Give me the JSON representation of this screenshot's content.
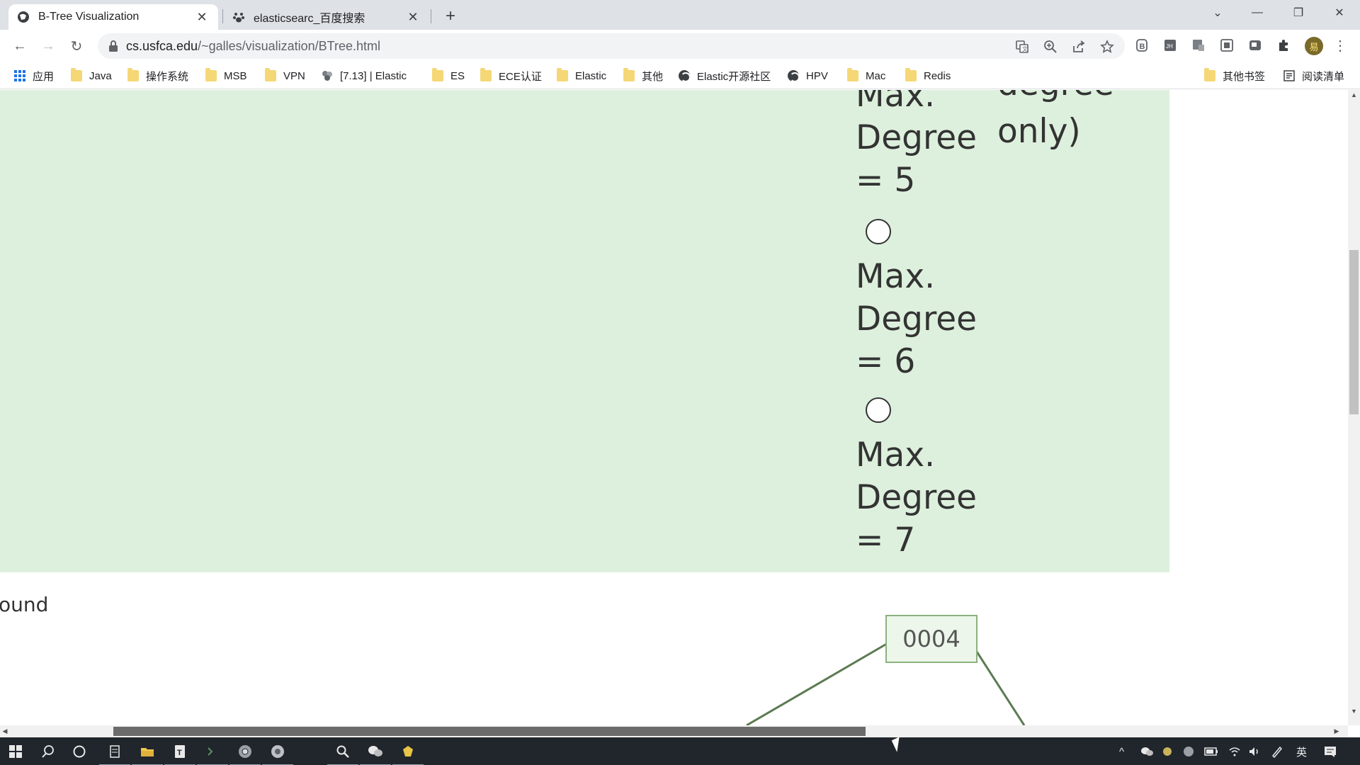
{
  "browser": {
    "tabs": [
      {
        "title": "B-Tree Visualization",
        "active": true,
        "icon": "globe-icon"
      },
      {
        "title": "elasticsearc_百度搜索",
        "active": false,
        "icon": "baidu-paw-icon"
      }
    ],
    "url_domain": "cs.usfca.edu",
    "url_path": "/~galles/visualization/BTree.html"
  },
  "bookmarks": [
    {
      "label": "应用",
      "icon": "apps-grid-icon"
    },
    {
      "label": "Java",
      "icon": "folder-icon"
    },
    {
      "label": "操作系统",
      "icon": "folder-icon"
    },
    {
      "label": "MSB",
      "icon": "folder-icon"
    },
    {
      "label": "VPN",
      "icon": "folder-icon"
    },
    {
      "label": "[7.13] | Elastic",
      "icon": "elastic-icon"
    },
    {
      "label": "ES",
      "icon": "folder-icon"
    },
    {
      "label": "ECE认证",
      "icon": "folder-icon"
    },
    {
      "label": "Elastic",
      "icon": "folder-icon"
    },
    {
      "label": "其他",
      "icon": "folder-icon"
    },
    {
      "label": "Elastic开源社区",
      "icon": "globe-icon"
    },
    {
      "label": "HPV",
      "icon": "globe-icon"
    },
    {
      "label": "Mac",
      "icon": "folder-icon"
    },
    {
      "label": "Redis",
      "icon": "folder-icon"
    },
    {
      "label": "其他书签",
      "icon": "folder-icon"
    },
    {
      "label": "阅读清单",
      "icon": "reading-list-icon"
    }
  ],
  "page": {
    "partial_top_left": "Max.",
    "partial_top_right": "degree",
    "right_text_only": "only)",
    "options": [
      {
        "line1": "Degree",
        "line2": "= 5"
      },
      {
        "line0": "Max.",
        "line1": "Degree",
        "line2": "= 6"
      },
      {
        "line0": "Max.",
        "line1": "Degree",
        "line2": "= 7"
      }
    ],
    "partial_found": "ound",
    "node_value": "0004"
  },
  "taskbar": {
    "ime": "英"
  },
  "colors": {
    "panel_green": "#ddf0dd",
    "node_border": "#8bb17e",
    "taskbar": "#20262c"
  }
}
